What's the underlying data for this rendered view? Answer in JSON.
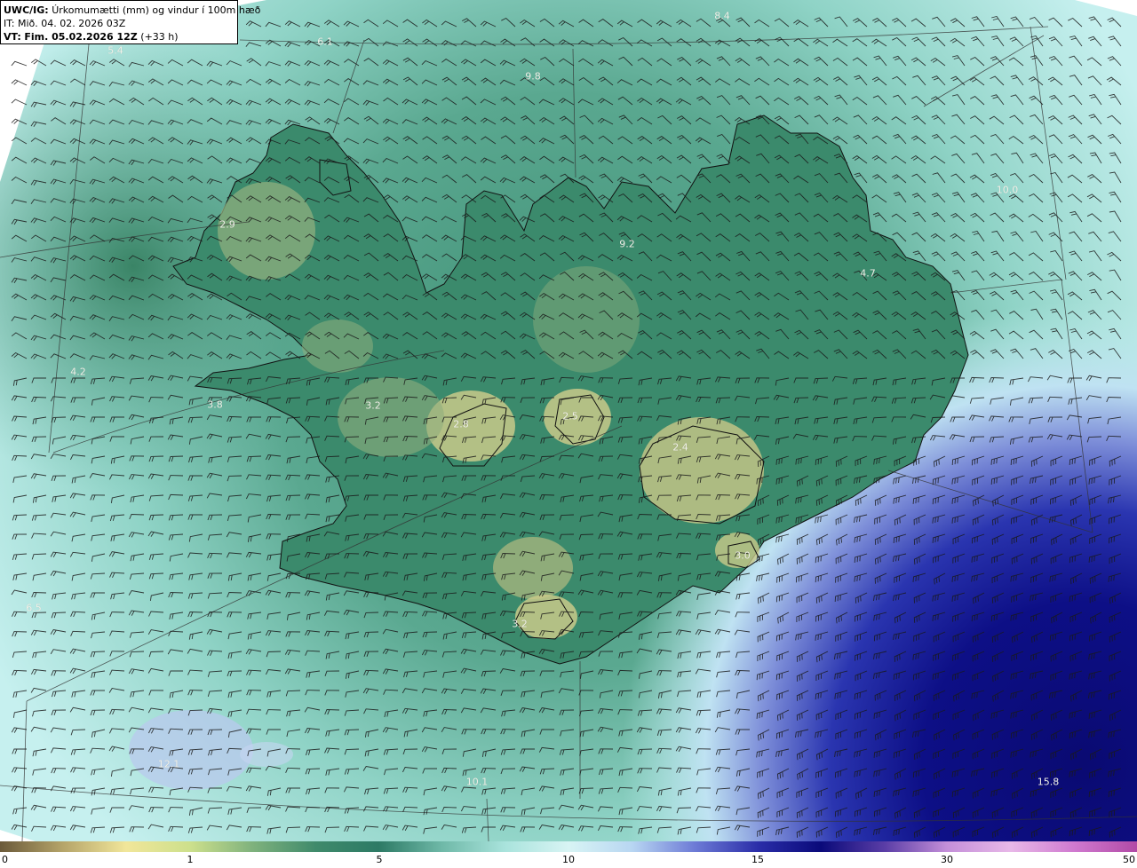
{
  "header": {
    "model": "UWC/IG:",
    "title": "Úrkomumætti (mm) og vindur í 100m hæð",
    "issue_time": "IT: Mið. 04. 02. 2026 03Z",
    "valid_prefix": "VT:",
    "valid_time": "Fim. 05.02.2026 12Z",
    "lead_time": "(+33 h)"
  },
  "value_labels": [
    "6.1",
    "5.4",
    "8.4",
    "9.8",
    "2.9",
    "10.0",
    "9.2",
    "4.7",
    "4.2",
    "3.8",
    "3.2",
    "2.8",
    "2.5",
    "2.4",
    "3.0",
    "3.2",
    "6.5",
    "12.1",
    "10.1",
    "15.8"
  ],
  "legend": {
    "ticks": [
      "0",
      "1",
      "5",
      "10",
      "15",
      "30",
      "50"
    ],
    "colors": [
      "#6b5a3a",
      "#b6a56a",
      "#f1e69a",
      "#cde08c",
      "#7fb27d",
      "#3f8a6b",
      "#2d7a65",
      "#6fb9a8",
      "#a9e3dc",
      "#d8f4f4",
      "#b8d6f2",
      "#6d7bd6",
      "#2a2da8",
      "#0a0a7a",
      "#5a3da6",
      "#c48fd9",
      "#e8b8e8",
      "#d07ad0",
      "#b24aa6"
    ]
  },
  "colors": {
    "land_high": "#c9c98a",
    "land_mid": "#8fae7d",
    "land_low": "#2f7a63",
    "sea_near": "#7fc7b9",
    "sea_far": "#bfeeee",
    "heavy": "#0a0a7a",
    "outline": "#111111"
  }
}
